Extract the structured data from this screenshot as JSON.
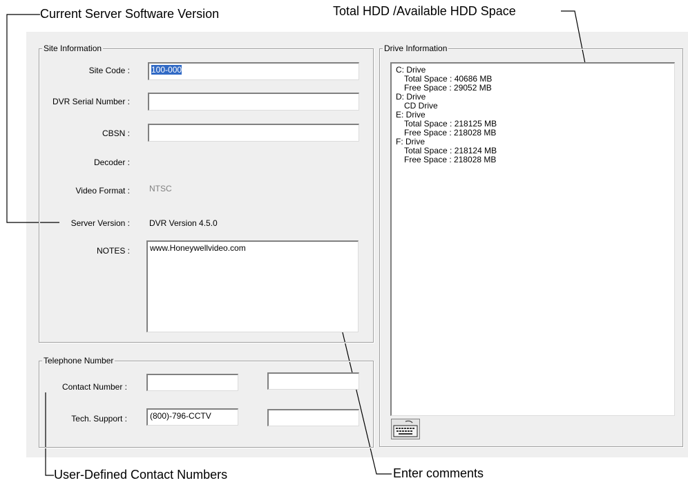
{
  "callouts": {
    "server_version": "Current Server Software Version",
    "hdd_space": "Total HDD /Available HDD Space",
    "contact_numbers": "User-Defined Contact Numbers",
    "comments": "Enter comments"
  },
  "site_info": {
    "legend": "Site Information",
    "site_code_label": "Site Code :",
    "site_code_value": "100-000",
    "dvr_serial_label": "DVR Serial Number :",
    "dvr_serial_value": "",
    "cbsn_label": "CBSN :",
    "cbsn_value": "",
    "decoder_label": "Decoder :",
    "decoder_value": "",
    "video_format_label": "Video Format :",
    "video_format_value": "NTSC",
    "server_version_label": "Server Version :",
    "server_version_value": "DVR Version 4.5.0",
    "notes_label": "NOTES :",
    "notes_value": "www.Honeywellvideo.com"
  },
  "telephone": {
    "legend": "Telephone Number",
    "contact_label": "Contact Number :",
    "contact_value_1": "",
    "contact_value_2": "",
    "tech_label": "Tech. Support :",
    "tech_value_1": "(800)-796-CCTV",
    "tech_value_2": ""
  },
  "drive_info": {
    "legend": "Drive Information",
    "lines": [
      "C: Drive",
      "Total Space : 40686 MB",
      "Free Space : 29052 MB",
      "D: Drive",
      "CD Drive",
      "E: Drive",
      "Total Space : 218125 MB",
      "Free Space : 218028 MB",
      "F: Drive",
      "Total Space : 218124 MB",
      "Free Space : 218028 MB"
    ],
    "keyboard_button_icon": "keyboard-icon"
  }
}
